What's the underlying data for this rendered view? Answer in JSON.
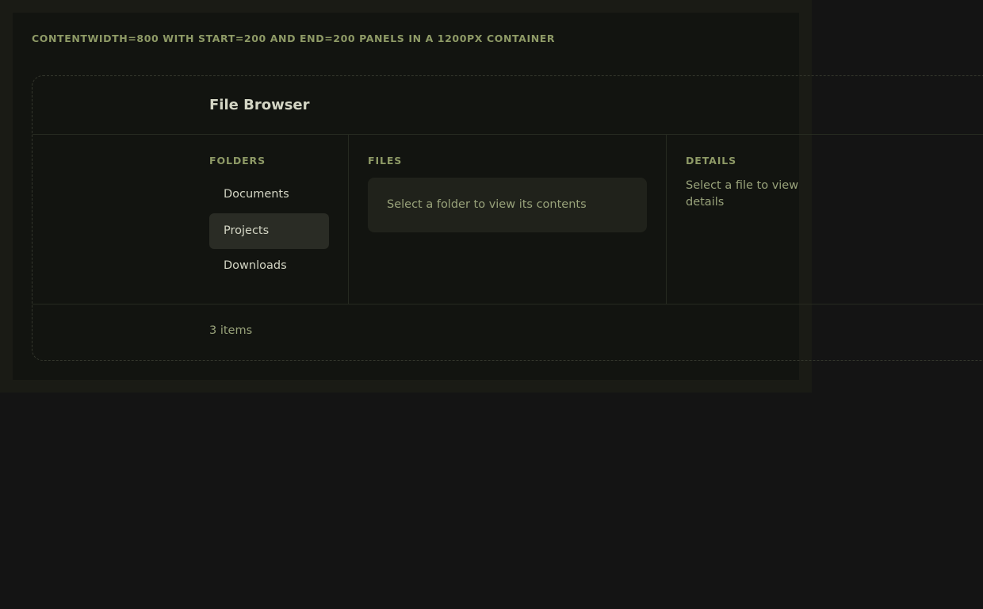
{
  "caption": "CONTENTWIDTH=800 WITH START=200 AND END=200 PANELS IN A 1200PX CONTAINER",
  "header": {
    "title": "File Browser"
  },
  "panels": {
    "folders": {
      "label": "FOLDERS",
      "items": [
        {
          "label": "Documents",
          "selected": false
        },
        {
          "label": "Projects",
          "selected": true
        },
        {
          "label": "Downloads",
          "selected": false
        }
      ]
    },
    "files": {
      "label": "FILES",
      "empty_message": "Select a folder to view its contents"
    },
    "details": {
      "label": "DETAILS",
      "empty_message": "Select a file to view details"
    }
  },
  "footer": {
    "count_text": "3 items"
  },
  "colors": {
    "page_background": "#141414",
    "panel_background": "#121410",
    "accent_label": "#8e9a66",
    "text_primary": "#d3d5c4",
    "text_muted": "#98a27a",
    "selected_background": "#2a2c25"
  }
}
